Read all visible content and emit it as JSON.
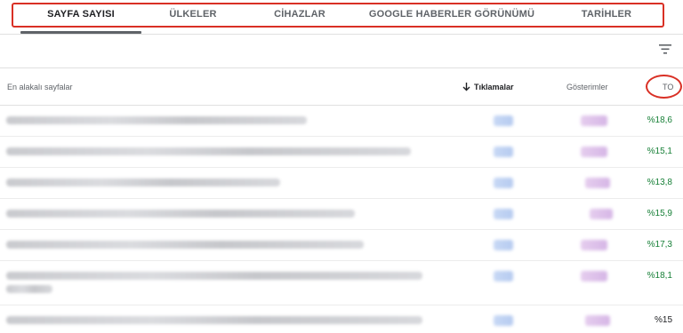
{
  "tabs": [
    {
      "label": "SAYFA SAYISI",
      "active": true
    },
    {
      "label": "ÜLKELER",
      "active": false
    },
    {
      "label": "CİHAZLAR",
      "active": false
    },
    {
      "label": "GOOGLE HABERLER GÖRÜNÜMÜ",
      "active": false
    },
    {
      "label": "TARİHLER",
      "active": false
    }
  ],
  "toolbar": {
    "filter_icon": "filter-list-icon"
  },
  "table": {
    "columns": {
      "pages": "En alakalı sayfalar",
      "clicks": "Tıklamalar",
      "impressions": "Gösterimler",
      "ctr": "TO"
    },
    "sort_icon": "arrow-down-icon",
    "rows": [
      {
        "ctr": "%18,6"
      },
      {
        "ctr": "%15,1"
      },
      {
        "ctr": "%13,8"
      },
      {
        "ctr": "%15,9"
      },
      {
        "ctr": "%17,3"
      },
      {
        "ctr": "%18,1"
      },
      {
        "ctr": "%15"
      }
    ]
  },
  "colors": {
    "highlight": "#d93025",
    "ctr_text": "#188038",
    "active_tab": "#202124"
  }
}
